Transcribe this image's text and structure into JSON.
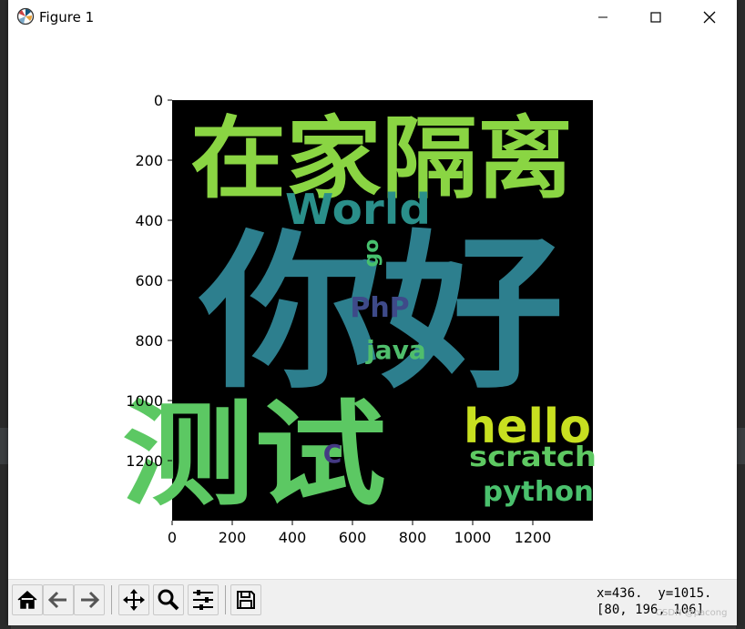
{
  "window": {
    "title": "Figure 1"
  },
  "figure": {
    "words": [
      {
        "text": "在家隔离",
        "color": "#8ad543"
      },
      {
        "text": "World",
        "color": "#2a8f8a"
      },
      {
        "text": "你好",
        "color": "#2d7f8e"
      },
      {
        "text": "go",
        "color": "#47c16e"
      },
      {
        "text": "PhP",
        "color": "#3e4a89"
      },
      {
        "text": "java",
        "color": "#4fbe6c"
      },
      {
        "text": "测试",
        "color": "#5cc863"
      },
      {
        "text": "C",
        "color": "#443983"
      },
      {
        "text": "hello",
        "color": "#c8e020"
      },
      {
        "text": "scratch",
        "color": "#5ec962"
      },
      {
        "text": "python",
        "color": "#4ac16d"
      }
    ],
    "x_ticks": [
      "0",
      "200",
      "400",
      "600",
      "800",
      "1000",
      "1200"
    ],
    "y_ticks": [
      "0",
      "200",
      "400",
      "600",
      "800",
      "1000",
      "1200"
    ],
    "background_color": "#000000"
  },
  "toolbar": {
    "buttons": [
      {
        "name": "home-button",
        "icon": "home-icon"
      },
      {
        "name": "back-button",
        "icon": "arrow-left-icon"
      },
      {
        "name": "forward-button",
        "icon": "arrow-right-icon"
      },
      {
        "name": "pan-button",
        "icon": "move-icon"
      },
      {
        "name": "zoom-button",
        "icon": "magnifier-icon"
      },
      {
        "name": "configure-subplots-button",
        "icon": "sliders-icon"
      },
      {
        "name": "save-button",
        "icon": "floppy-disk-icon"
      }
    ],
    "status_line1": "x=436.  y=1015.",
    "status_line2": "[80, 196, 106]"
  },
  "watermark": "CSDN @pacong"
}
